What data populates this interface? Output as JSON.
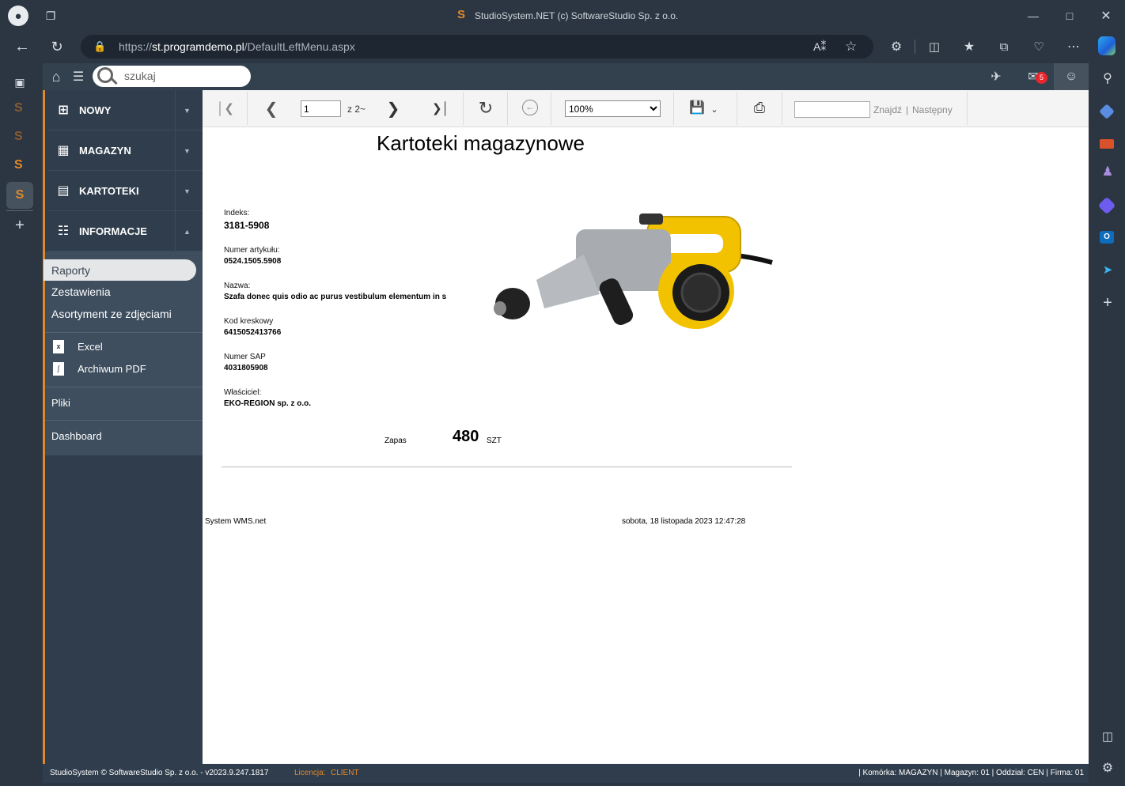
{
  "browser": {
    "title": "StudioSystem.NET (c) SoftwareStudio Sp. z o.o.",
    "url_host": "https://st.programdemo.pl",
    "url_prefix": "https://",
    "url_domain": "st.programdemo.pl",
    "url_path": "/DefaultLeftMenu.aspx"
  },
  "app": {
    "search_placeholder": "szukaj",
    "mail_count": "5"
  },
  "menu": {
    "items": [
      {
        "label": "NOWY",
        "icon": "plus-square-icon"
      },
      {
        "label": "MAGAZYN",
        "icon": "pallet-icon"
      },
      {
        "label": "KARTOTEKI",
        "icon": "card-list-icon"
      },
      {
        "label": "INFORMACJE",
        "icon": "document-icon"
      }
    ],
    "sub": {
      "raporty": "Raporty",
      "zestawienia": "Zestawienia",
      "asortyment": "Asortyment ze zdjęciami",
      "excel": "Excel",
      "archiwum": "Archiwum PDF",
      "pliki": "Pliki",
      "dashboard": "Dashboard"
    }
  },
  "viewer": {
    "page": "1",
    "of_pages": "z 2~",
    "zoom": "100%",
    "zoom_options": [
      "100%"
    ],
    "find": "Znajdź",
    "sep": "|",
    "next": "Następny"
  },
  "report": {
    "title": "Kartoteki magazynowe",
    "indeks_label": "Indeks:",
    "indeks": "3181-5908",
    "numer_label": "Numer artykułu:",
    "numer": "0524.1505.5908",
    "nazwa_label": "Nazwa:",
    "nazwa": "Szafa donec quis odio ac purus vestibulum elementum in s",
    "kod_label": "Kod kreskowy",
    "kod": "6415052413766",
    "sap_label": "Numer SAP",
    "sap": "4031805908",
    "wlasciciel_label": "Właściciel:",
    "wlasciciel": "EKO-REGION sp. z o.o.",
    "zapas_label": "Zapas",
    "zapas": "480",
    "unit": "SZT",
    "footer_left": "System WMS.net",
    "footer_right": "sobota, 18 listopada 2023 12:47:28"
  },
  "status": {
    "left": "StudioSystem © SoftwareStudio Sp. z o.o. - v2023.9.247.1817",
    "licencja_label": "Licencja:",
    "licencja": "CLIENT",
    "right": "| Komórka: MAGAZYN | Magazyn: 01 | Oddział: CEN | Firma: 01"
  },
  "colors": {
    "accent": "#e0892a",
    "menu_bg": "#2f3d4c",
    "sub_bg": "#3e4e5e",
    "badge": "#e8262b"
  }
}
